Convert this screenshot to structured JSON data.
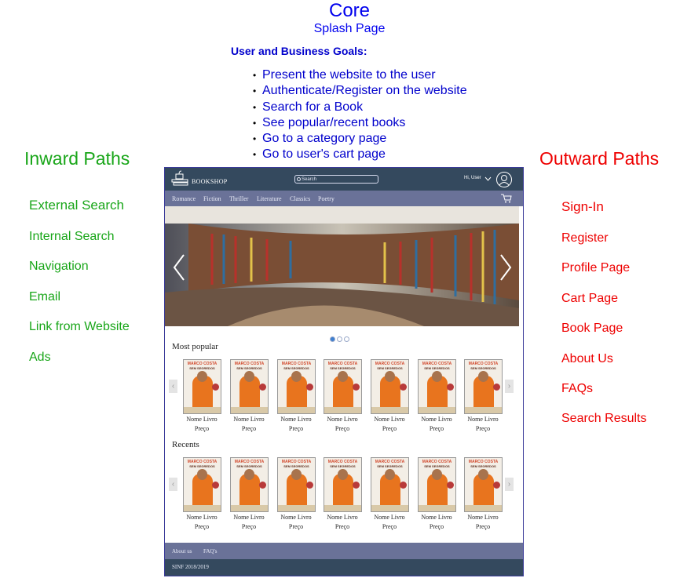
{
  "header": {
    "title": "Core",
    "subtitle": "Splash Page"
  },
  "goals": {
    "heading": "User and Business Goals:",
    "items": [
      "Present the website to the user",
      "Authenticate/Register on the website",
      "Search for a Book",
      "See popular/recent books",
      "Go to a category page",
      "Go to user's cart page"
    ]
  },
  "inward": {
    "heading": "Inward Paths",
    "items": [
      "External Search",
      "Internal Search",
      "Navigation",
      "Email",
      "Link from Website",
      "Ads"
    ]
  },
  "outward": {
    "heading": "Outward Paths",
    "items": [
      "Sign-In",
      "Register",
      "Profile Page",
      "Cart Page",
      "Book Page",
      "About Us",
      "FAQs",
      "Search Results"
    ]
  },
  "mockup": {
    "brand": "BOOKSHOP",
    "search_placeholder": "Search",
    "greeting": "Hi, User",
    "nav": [
      "Romance",
      "Fiction",
      "Thriller",
      "Literature",
      "Classics",
      "Poetry"
    ],
    "sections": [
      {
        "title": "Most popular"
      },
      {
        "title": "Recents"
      }
    ],
    "book": {
      "author": "MARCO COSTA",
      "subtitle": "SEM SEGREDOS",
      "name": "Nome Livro",
      "price": "Preço"
    },
    "footer_links": [
      "About us",
      "FAQ's"
    ],
    "footer_note": "SINF 2018/2019",
    "colors": {
      "header": "#34495e",
      "nav": "#6a7298"
    },
    "icons": [
      "logo-icon",
      "search-icon",
      "chevron-down-icon",
      "user-icon",
      "cart-icon",
      "chevron-left-icon",
      "chevron-right-icon"
    ]
  }
}
